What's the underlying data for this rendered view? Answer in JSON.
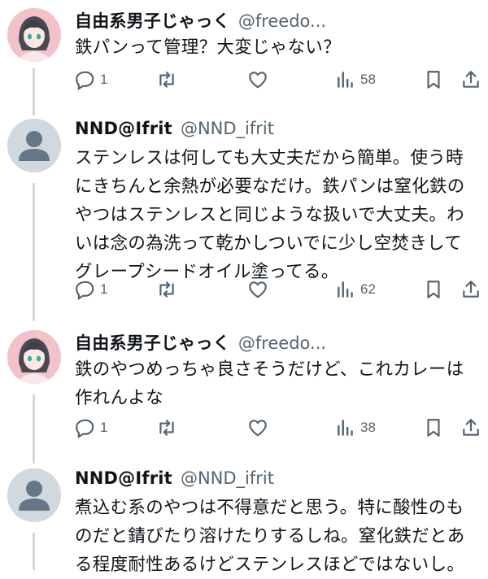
{
  "tweets": [
    {
      "author": "自由系男子じゃっく",
      "handle": "@freedo...",
      "text": "鉄パンって管理？大変じゃない？",
      "replies": "1",
      "views": "58"
    },
    {
      "author": "NND@Ifrit",
      "handle": "@NND_ifrit",
      "text": "ステンレスは何しても大丈夫だから簡単。使う時にきちんと余熱が必要なだけ。鉄パンは窒化鉄のやつはステンレスと同じような扱いで大丈夫。わいは念の為洗って乾かしついでに少し空焚きしてグレープシードオイル塗ってる。",
      "replies": "1",
      "views": "62"
    },
    {
      "author": "自由系男子じゃっく",
      "handle": "@freedo...",
      "text": "鉄のやつめっちゃ良さそうだけど、これカレーは作れんよな",
      "replies": "1",
      "views": "38"
    },
    {
      "author": "NND@Ifrit",
      "handle": "@NND_ifrit",
      "text": "煮込む系のやつは不得意だと思う。特に酸性のものだと錆びたり溶けたりするしね。窒化鉄だとある程度耐性あるけどステンレスほどではないし。"
    }
  ],
  "icons": {
    "reply": "reply-icon",
    "retweet": "retweet-icon",
    "like": "like-icon",
    "views": "views-icon",
    "bookmark": "bookmark-icon",
    "share": "share-icon"
  },
  "colors": {
    "text": "#0f1419",
    "secondary": "#536471",
    "thread_line": "#cfd9de",
    "anime_avatar_bg": "#f6c9cf"
  }
}
